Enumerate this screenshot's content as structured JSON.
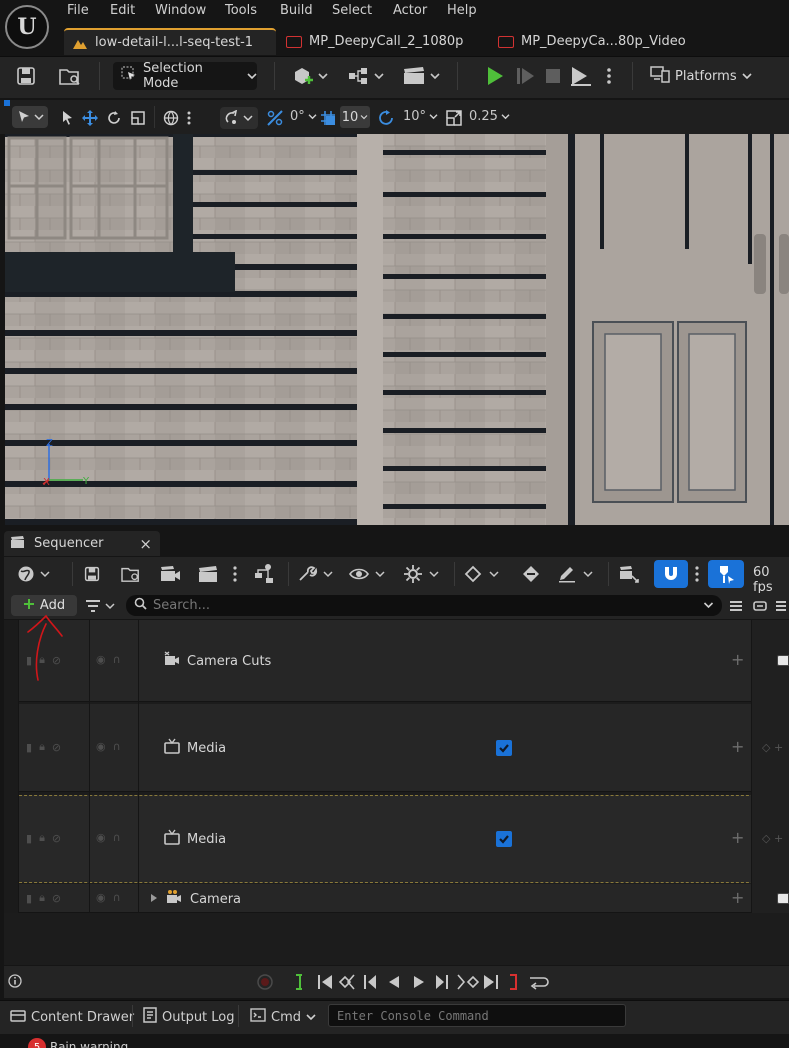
{
  "app": {
    "logo": "U",
    "menu": [
      "File",
      "Edit",
      "Window",
      "Tools",
      "Build",
      "Select",
      "Actor",
      "Help"
    ],
    "tabs": [
      {
        "label": "low-detail-l...l-seq-test-1"
      },
      {
        "label": "MP_DeepyCall_2_1080p"
      },
      {
        "label": "MP_DeepyCa...80p_Video"
      }
    ]
  },
  "toolbar": {
    "selection_mode": "Selection Mode",
    "platforms": "Platforms"
  },
  "viewport_toolbar": {
    "rotation_snap_value": "0°",
    "grid_snap_value": "10",
    "angle_snap_value": "10°",
    "scale_snap_value": "0.25"
  },
  "viewport": {
    "axis_z": "Z",
    "axis_y": "Y",
    "axis_x": "X"
  },
  "sequencer": {
    "tab_label": "Sequencer",
    "close": "×",
    "fps": "60 fps",
    "add_label": "Add",
    "search_placeholder": "Search...",
    "tracks": [
      {
        "name": "Camera Cuts",
        "has_checkbox": false
      },
      {
        "name": "Media",
        "has_checkbox": true
      },
      {
        "name": "Media",
        "has_checkbox": true
      },
      {
        "name": "Camera",
        "has_checkbox": false
      }
    ],
    "plus": "+"
  },
  "statusbar": {
    "content_drawer": "Content Drawer",
    "output_log": "Output Log",
    "cmd": "Cmd",
    "console_placeholder": "Enter Console Command",
    "warning_count": "5",
    "warning_text": "Rain warning"
  },
  "colors": {
    "accent_blue": "#1a72d8",
    "play_green": "#4fbf3a",
    "level_tab_accent": "#e0a030",
    "annotation_red": "#d0161a"
  }
}
